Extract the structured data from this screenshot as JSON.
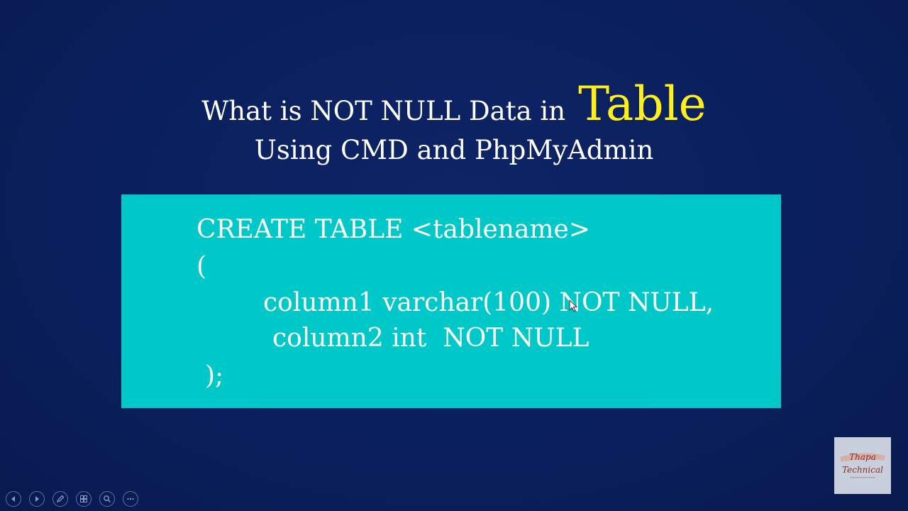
{
  "slide": {
    "title": {
      "line1_text": "What is NOT NULL Data in",
      "line1_accent": "Table",
      "line2": "Using CMD and PhpMyAdmin"
    },
    "code_lines": [
      "CREATE TABLE <tablename>",
      "(",
      "column1 varchar(100) NOT NULL,",
      "column2 int  NOT NULL",
      ");"
    ],
    "colors": {
      "background": "#0a1f5c",
      "code_box": "#00c8c8",
      "accent": "#ffef1a",
      "text": "#ffffff"
    }
  },
  "toolbar": {
    "buttons": [
      {
        "icon": "previous-icon"
      },
      {
        "icon": "next-icon"
      },
      {
        "icon": "pen-icon"
      },
      {
        "icon": "slides-icon"
      },
      {
        "icon": "zoom-icon"
      },
      {
        "icon": "more-icon"
      }
    ]
  },
  "logo": {
    "line1": "Thapa",
    "line2": "Technical"
  }
}
